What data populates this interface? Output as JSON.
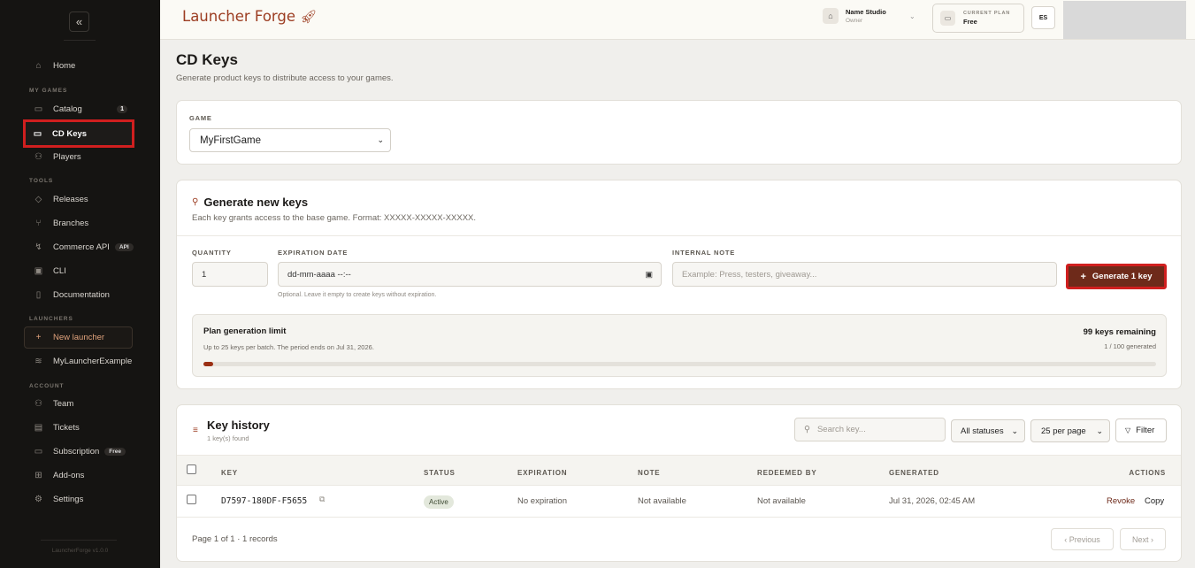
{
  "sidebar": {
    "collapse_icon": "«",
    "home": "Home",
    "section_games": "MY GAMES",
    "catalog": "Catalog",
    "catalog_count": "1",
    "cd_keys": "CD Keys",
    "players": "Players",
    "section_tools": "TOOLS",
    "releases": "Releases",
    "branches": "Branches",
    "commerce_api": "Commerce API",
    "api_badge": "API",
    "cli": "CLI",
    "documentation": "Documentation",
    "section_launchers": "LAUNCHERS",
    "new_launcher": "New launcher",
    "launcher_example": "MyLauncherExample",
    "section_account": "ACCOUNT",
    "team": "Team",
    "tickets": "Tickets",
    "subscription": "Subscription",
    "subscription_badge": "Free",
    "addons": "Add-ons",
    "settings": "Settings",
    "version": "LauncherForge v1.0.0"
  },
  "header": {
    "logo": "Launcher Forge",
    "studio_name": "Name Studio",
    "studio_role": "Owner",
    "plan_label": "CURRENT PLAN",
    "plan_value": "Free",
    "lang": "ES"
  },
  "page": {
    "title": "CD Keys",
    "subtitle": "Generate product keys to distribute access to your games."
  },
  "game_card": {
    "label": "GAME",
    "selected": "MyFirstGame"
  },
  "generate": {
    "title": "Generate new keys",
    "description": "Each key grants access to the base game. Format: XXXXX-XXXXX-XXXXX.",
    "qty_label": "QUANTITY",
    "qty_value": "1",
    "exp_label": "EXPIRATION DATE",
    "exp_placeholder": "dd-mm-aaaa --:--",
    "exp_hint": "Optional. Leave it empty to create keys without expiration.",
    "note_label": "INTERNAL NOTE",
    "note_placeholder": "Example: Press, testers, giveaway...",
    "button": "Generate 1 key",
    "limit_title": "Plan generation limit",
    "limit_desc": "Up to 25 keys per batch. The period ends on Jul 31, 2026.",
    "remaining": "99 keys remaining",
    "generated": "1 / 100 generated",
    "usage_fraction": 0.01
  },
  "history": {
    "title": "Key history",
    "count": "1 key(s) found",
    "search_placeholder": "Search key...",
    "status_filter": "All statuses",
    "per_page": "25 per page",
    "filter_button": "Filter",
    "columns": {
      "key": "KEY",
      "status": "STATUS",
      "expiration": "EXPIRATION",
      "note": "NOTE",
      "redeemed_by": "REDEEMED BY",
      "generated": "GENERATED",
      "actions": "ACTIONS"
    },
    "rows": [
      {
        "key": "D7597-180DF-F5655",
        "status": "Active",
        "expiration": "No expiration",
        "note": "Not available",
        "redeemed_by": "Not available",
        "generated": "Jul 31, 2026, 02:45 AM",
        "revoke": "Revoke",
        "copy": "Copy"
      }
    ],
    "pagination": "Page 1 of 1 · 1 records",
    "prev": "‹ Previous",
    "next": "Next ›"
  }
}
